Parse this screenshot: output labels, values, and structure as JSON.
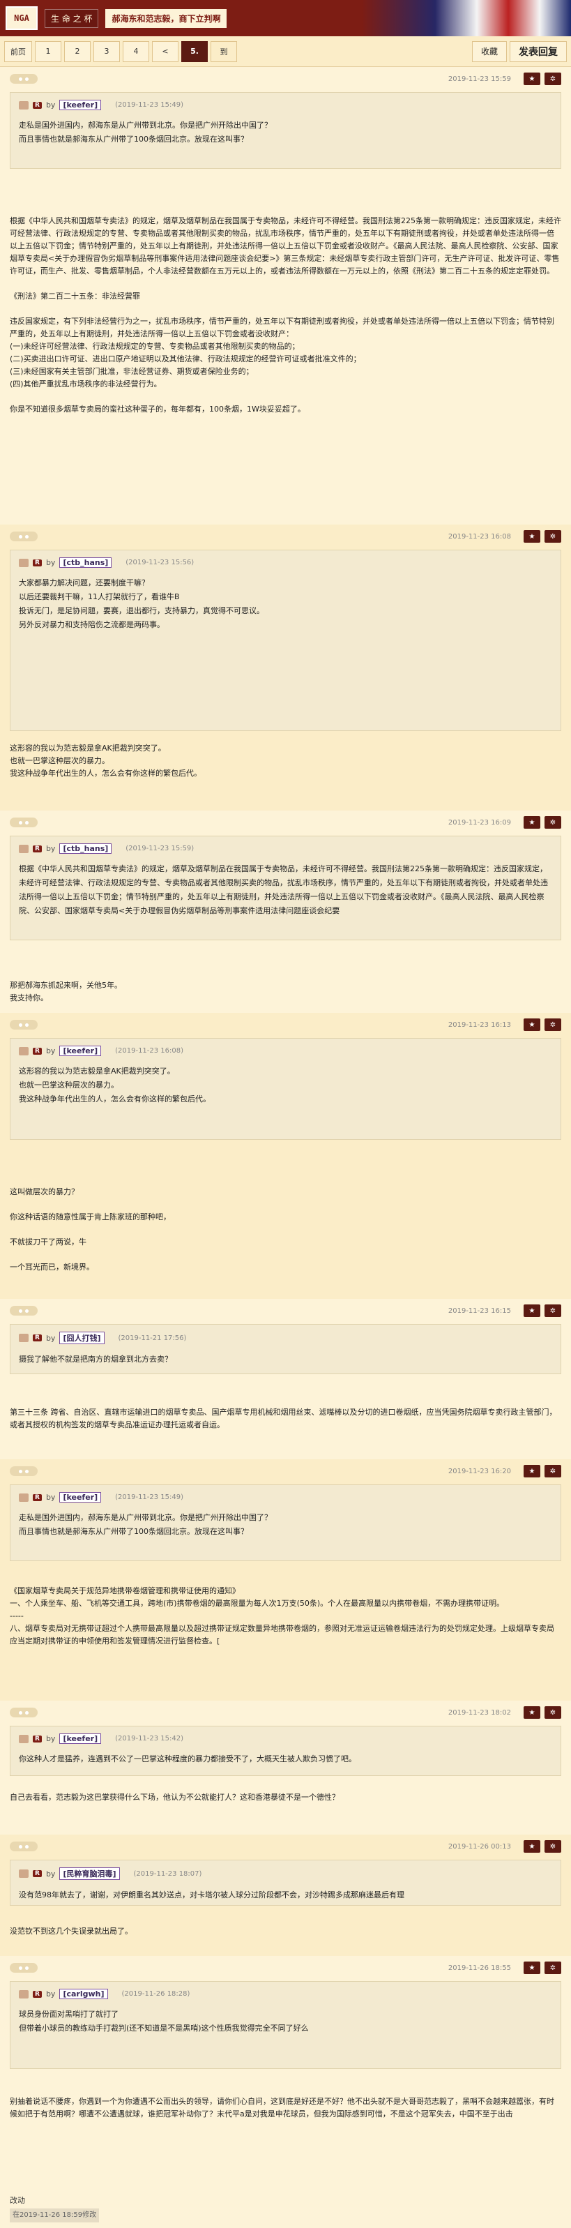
{
  "header": {
    "logo": "NGA",
    "board": "生 命 之 杯",
    "title": "郝海东和范志毅，商下立判啊"
  },
  "pager": {
    "pages": [
      "前页",
      "1",
      "2",
      "3",
      "4",
      "<",
      "5.",
      "到"
    ],
    "current": "5.",
    "bookmark": "收藏",
    "reply": "发表回复"
  },
  "posts": [
    {
      "time": "2019-11-23 15:59",
      "quote": {
        "user": "keefer",
        "time": "(2019-11-23 15:49)",
        "lines": [
          "走私是国外进国内，郝海东是从广州带到北京。你是把广州开除出中国了？",
          "而且事情也就是郝海东从广州带了100条烟回北京。放现在这叫事？"
        ]
      },
      "body": [
        "根据《中华人民共和国烟草专卖法》的规定，烟草及烟草制品在我国属于专卖物品，未经许可不得经营。我国刑法第225条第一款明确规定：违反国家规定，未经许可经营法律、行政法规规定的专营、专卖物品或者其他限制买卖的物品，扰乱市场秩序，情节严重的，处五年以下有期徒刑或者拘役，并处或者单处违法所得一倍以上五倍以下罚金；情节特别严重的，处五年以上有期徒刑，并处违法所得一倍以上五倍以下罚金或者没收财产。《最高人民法院、最高人民检察院、公安部、国家烟草专卖局<关于办理假冒伪劣烟草制品等刑事案件适用法律问题座谈会纪要>》第三条规定：未经烟草专卖行政主管部门许可，无生产许可证、批发许可证、零售许可证，而生产、批发、零售烟草制品，个人非法经营数额在五万元以上的，或者违法所得数额在一万元以上的，依照《刑法》第二百二十五条的规定定罪处罚。",
        "",
        "《刑法》第二百二十五条：非法经营罪",
        "",
        "违反国家规定，有下列非法经营行为之一，扰乱市场秩序，情节严重的，处五年以下有期徒刑或者拘役，并处或者单处违法所得一倍以上五倍以下罚金；情节特别严重的，处五年以上有期徒刑，并处违法所得一倍以上五倍以下罚金或者没收财产：",
        "(一)未经许可经营法律、行政法规规定的专营、专卖物品或者其他限制买卖的物品的；",
        "(二)买卖进出口许可证、进出口原产地证明以及其他法律、行政法规规定的经营许可证或者批准文件的；",
        "(三)未经国家有关主管部门批准，非法经营证券、期货或者保险业务的；",
        "(四)其他严重扰乱市场秩序的非法经营行为。",
        "",
        "你是不知道很多烟草专卖局的蛮社这种蛋子的，每年都有，100条烟，1W块妥妥超了。"
      ]
    },
    {
      "time": "2019-11-23 16:08",
      "quote": {
        "user": "ctb_hans",
        "time": "(2019-11-23 15:56)",
        "lines": [
          "大家都暴力解决问题，还要制度干嘛？",
          "",
          "以后还要裁判干嘛，11人打架就行了，看谁牛B",
          "",
          "投诉无门，是足协问题，要赛，退出都行，支持暴力，真觉得不可思议。",
          "",
          "另外反对暴力和支持陪伤之流都是两码事。"
        ]
      },
      "body": [
        "这形容的我以为范志毅是拿AK把裁判突突了。",
        "也就一巴掌这种层次的暴力。",
        "我这种战争年代出生的人，怎么会有你这样的繁包后代。"
      ]
    },
    {
      "time": "2019-11-23 16:09",
      "quote": {
        "user": "ctb_hans",
        "time": "(2019-11-23 15:59)",
        "lines": [
          "根据《中华人民共和国烟草专卖法》的规定，烟草及烟草制品在我国属于专卖物品，未经许可不得经营。我国刑法第225条第一款明确规定：违反国家规定，未经许可经营法律、行政法规规定的专营、专卖物品或者其他限制买卖的物品，扰乱市场秩序，情节严重的，处五年以下有期徒刑或者拘役，并处或者单处违法所得一倍以上五倍以下罚金；情节特别严重的，处五年以上有期徒刑，并处违法所得一倍以上五倍以下罚金或者没收财产。《最高人民法院、最高人民检察院、公安部、国家烟草专卖局<关于办理假冒伪劣烟草制品等刑事案件适用法律问题座谈会纪要"
        ]
      },
      "body": [
        "那把郝海东抓起来啊，关他5年。",
        "我支持你。"
      ]
    },
    {
      "time": "2019-11-23 16:13",
      "quote": {
        "user": "keefer",
        "time": "(2019-11-23 16:08)",
        "lines": [
          "这形容的我以为范志毅是拿AK把裁判突突了。",
          "也就一巴掌这种层次的暴力。",
          "我这种战争年代出生的人，怎么会有你这样的繁包后代。"
        ]
      },
      "body": [
        "这叫做层次的暴力？",
        "",
        "你这种话语的随意性属于肯上陈家班的那种吧，",
        "",
        "不就拔刀干了两说，牛",
        "",
        "一个耳光而已，新境界。"
      ]
    },
    {
      "time": "2019-11-23 16:15",
      "quote": {
        "user": "囧人打钱",
        "time": "(2019-11-21 17:56)",
        "lines": [
          "摄我了解他不就是把南方的烟拿到北方去卖？"
        ]
      },
      "body": [
        "第三十三条 跨省、自治区、直辖市运输进口的烟草专卖品、国产烟草专用机械和烟用丝束、滤嘴棒以及分切的进口卷烟纸，应当凭国务院烟草专卖行政主管部门，或者其授权的机构签发的烟草专卖品准运证办理托运或者自运。"
      ]
    },
    {
      "time": "2019-11-23 16:20",
      "quote": {
        "user": "keefer",
        "time": "(2019-11-23 15:49)",
        "lines": [
          "走私是国外进国内，郝海东是从广州带到北京。你是把广州开除出中国了？",
          "而且事情也就是郝海东从广州带了100条烟回北京。放现在这叫事？"
        ]
      },
      "body": [
        "《国家烟草专卖局关于规范异地携带卷烟管理和携带证使用的通知》",
        "一、个人乘坐车、船、飞机等交通工具，跨地(市)携带卷烟的最高限量为每人次1万支(50条)。个人在最高限量以内携带卷烟，不需办理携带证明。",
        "-----",
        "八、烟草专卖局对无携带证超过个人携带最高限量以及超过携带证规定数量异地携带卷烟的，参照对无准运证运输卷烟违法行为的处罚规定处理。上级烟草专卖局应当定期对携带证的申领使用和签发管理情况进行监督检查。["
      ]
    },
    {
      "time": "2019-11-23 18:02",
      "quote": {
        "user": "keefer",
        "time": "(2019-11-23 15:42)",
        "lines": [
          "你这种人才是猛养，连遇到不公了一巴掌这种程度的暴力都接受不了，大概天生被人欺负习惯了吧。"
        ]
      },
      "body": [
        "自己去看看，范志毅为这巴掌获得什么下场，他认为不公就能打人？这和香港暴徒不是一个德性？"
      ]
    },
    {
      "time": "2019-11-26 00:13",
      "quote": {
        "user": "民粹育脑泪毒",
        "time": "(2019-11-23 18:07)",
        "lines": [
          "没有范98年就去了，谢谢，对伊朗重名其妙送点，对卡塔尔被人球分过阶段都不会，对沙特踢多成那麻迷最后有理"
        ]
      },
      "body": [
        "没范钦不到这几个失误录就出局了。"
      ]
    },
    {
      "time": "2019-11-26 18:55",
      "quote": {
        "user": "carlgwh",
        "time": "(2019-11-26 18:28)",
        "lines": [
          "球员身份面对黑哨打了就打了",
          "但带着小球员的教练动手打裁判(还不知道是不是黑哨)这个性质我觉得完全不同了好么"
        ]
      },
      "body": [
        "别抽着说话不腰疼，你遇到一个为你遭遇不公而出头的领导，请你们心自问，这到底是好还是不好？他不出头就不是大哥哥范志毅了，黑哨不会越来越嚣张，有时候如把于有范用啊？哪遭不公遭遇就球，谁把冠军补动你了？末代平a是对我是申花球员，但我为国际感到可惜，不是这个冠军失去，中国不至于出击"
      ],
      "edit": {
        "label": "改动",
        "stamp": "在2019-11-26 18:59修改"
      }
    }
  ]
}
